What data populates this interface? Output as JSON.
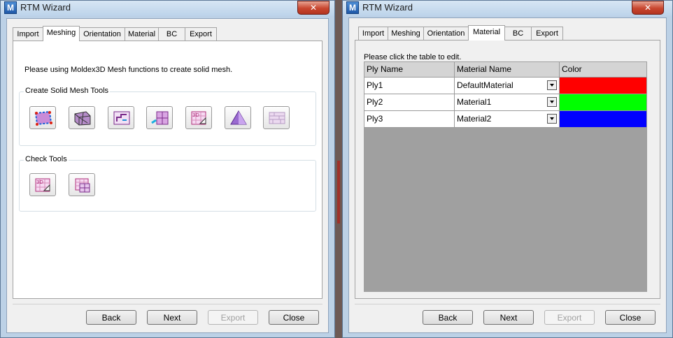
{
  "left_window": {
    "title": "RTM Wizard",
    "tabs": [
      "Import",
      "Meshing",
      "Orientation",
      "Material",
      "BC",
      "Export"
    ],
    "active_tab": "Meshing",
    "info_text": "Please using Moldex3D Mesh functions to create solid mesh.",
    "group_create": "Create Solid Mesh Tools",
    "group_check": "Check Tools",
    "buttons": {
      "back": "Back",
      "next": "Next",
      "export": "Export",
      "close": "Close"
    }
  },
  "right_window": {
    "title": "RTM Wizard",
    "tabs": [
      "Import",
      "Meshing",
      "Orientation",
      "Material",
      "BC",
      "Export"
    ],
    "active_tab": "Material",
    "hint": "Please click the table to edit.",
    "table": {
      "columns": [
        "Ply Name",
        "Material Name",
        "Color"
      ],
      "rows": [
        {
          "ply": "Ply1",
          "material": "DefaultMaterial",
          "color": "#ff0000"
        },
        {
          "ply": "Ply2",
          "material": "Material1",
          "color": "#00ff00"
        },
        {
          "ply": "Ply3",
          "material": "Material2",
          "color": "#0000ff"
        }
      ]
    },
    "buttons": {
      "back": "Back",
      "next": "Next",
      "export": "Export",
      "close": "Close"
    }
  },
  "icons": {
    "app": "moldex-icon",
    "close": "close-icon"
  }
}
